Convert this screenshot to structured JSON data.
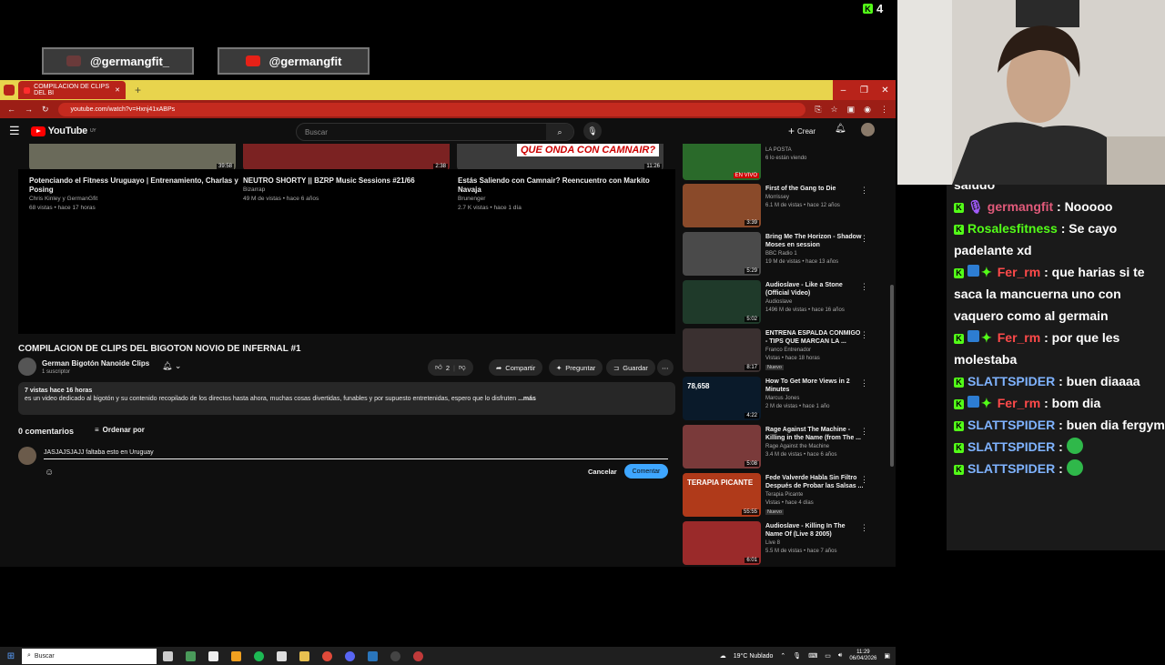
{
  "overlay": {
    "social_left": "@germangfit_",
    "social_right": "@germangfit",
    "kick_viewers": "4"
  },
  "browser": {
    "tab_title": "COMPILACION DE CLIPS DEL BI",
    "url": "youtube.com/watch?v=Hxnj41xABPs"
  },
  "youtube": {
    "logo": "YouTube",
    "logo_suffix": "UY",
    "search_placeholder": "Buscar",
    "create_label": "Crear",
    "related_top": [
      {
        "title": "Potenciando el Fitness Uruguayo | Entrenamiento, Charlas y Posing",
        "channel": "Chris Kinley y GermanGfit",
        "meta": "68 vistas • hace 17 horas",
        "duration": "39:58",
        "color": "#6a6a5a"
      },
      {
        "title": "NEUTRO SHORTY || BZRP Music Sessions #21/66",
        "channel": "Bizarrap",
        "meta": "49 M de vistas • hace 6 años",
        "duration": "2:38",
        "color": "#7b2222"
      },
      {
        "title": "Estás Saliendo con Camnair? Reencuentro con Markito Navaja",
        "channel": "Brunenger",
        "meta": "2.7 K vistas • hace 1 día",
        "duration": "11:26",
        "color": "#3b3b3b",
        "thumb_text": "QUE ONDA CON CAMNAIR?"
      }
    ],
    "video": {
      "title": "COMPILACION DE CLIPS DEL BIGOTON NOVIO DE INFERNAL #1",
      "channel": "German Bigotón Nanoide Clips",
      "subs": "1 suscriptor",
      "likes": "2",
      "share": "Compartir",
      "ask": "Preguntar",
      "save": "Guardar",
      "desc_stats": "7 vistas  hace 16 horas",
      "desc_text": "es un video dedicado al bigotón y su contenido recopilado de los directos hasta ahora, muchas cosas divertidas, funables y por supuesto entretenidas, espero que lo disfruten",
      "desc_more": "...más"
    },
    "comments": {
      "count": "0 comentarios",
      "sort": "Ordenar por",
      "draft": "JASJAJSJAJJ faltaba esto en Uruguay",
      "cancel": "Cancelar",
      "submit": "Comentar"
    },
    "sidebar": [
      {
        "title": "EN VIVO",
        "channel": "LA POSTA",
        "meta": "6 lo están viendo",
        "badge": "EN VIVO",
        "color": "#2a6a2a"
      },
      {
        "title": "First of the Gang to Die",
        "channel": "Morrissey",
        "meta": "6.1 M de vistas • hace 12 años",
        "duration": "3:39",
        "color": "#8a4a2a"
      },
      {
        "title": "Bring Me The Horizon - Shadow Moses en session",
        "channel": "BBC Radio 1",
        "meta": "19 M de vistas • hace 13 años",
        "duration": "5:29",
        "color": "#4a4a4a"
      },
      {
        "title": "Audioslave - Like a Stone (Official Video)",
        "channel": "Audioslave",
        "meta": "1496 M de vistas • hace 16 años",
        "duration": "5:02",
        "color": "#1f3a2a"
      },
      {
        "title": "ENTRENA ESPALDA CONMIGO - TIPS QUE MARCAN LA ...",
        "channel": "Franco Entrenador",
        "meta": "Vistas • hace 18 horas",
        "badge": "Nuevo",
        "duration": "8:17",
        "color": "#3a3030"
      },
      {
        "title": "How To Get More Views in 2 Minutes",
        "channel": "Marcus Jones",
        "meta": "2 M de vistas • hace 1 año",
        "duration": "4:22",
        "color": "#0a1a2a",
        "thumb_text": "78,658"
      },
      {
        "title": "Rage Against The Machine - Killing in the Name (from The ...",
        "channel": "Rage Against the Machine",
        "meta": "3.4 M de vistas • hace 6 años",
        "duration": "5:08",
        "color": "#7a3a3a"
      },
      {
        "title": "Fede Valverde Habla Sin Filtro Después de Probar las Salsas ...",
        "channel": "Terapia Picante",
        "meta": "Vistas • hace 4 días",
        "badge": "Nuevo",
        "duration": "55:55",
        "color": "#b03a1a",
        "thumb_text": "TERAPIA PICANTE"
      },
      {
        "title": "Audioslave - Killing In The Name Of (Live 8 2005)",
        "channel": "Live 8",
        "meta": "5.5 M de vistas • hace 7 años",
        "duration": "6:01",
        "color": "#9a2a2a"
      }
    ]
  },
  "taskbar": {
    "search": "Buscar",
    "weather": "19°C  Nublado",
    "time": "11:29",
    "date": "06/04/2026"
  },
  "chat": [
    {
      "user": "",
      "text": "saludo",
      "user_color": "#ffffff"
    },
    {
      "user": "germangfit",
      "text": ": Nooooo",
      "user_color": "#e05a7a",
      "badges": [
        "mic"
      ]
    },
    {
      "user": "Rosalesfitness",
      "text": ": Se cayo padelante xd",
      "user_color": "#53fc18"
    },
    {
      "user": "Fer_rm",
      "text": ": que harias si te saca la mancuerna uno con vaquero como al germain",
      "user_color": "#ff4a4a",
      "badges": [
        "sub",
        "gift"
      ]
    },
    {
      "user": "Fer_rm",
      "text": ": por que les molestaba",
      "user_color": "#ff4a4a",
      "badges": [
        "sub",
        "gift"
      ]
    },
    {
      "user": "SLATTSPIDER",
      "text": ": buen diaaaa",
      "user_color": "#7fb3ff"
    },
    {
      "user": "Fer_rm",
      "text": ": bom dia",
      "user_color": "#ff4a4a",
      "badges": [
        "sub",
        "gift"
      ]
    },
    {
      "user": "SLATTSPIDER",
      "text": ": buen dia fergym",
      "user_color": "#7fb3ff"
    },
    {
      "user": "SLATTSPIDER",
      "text": ":",
      "user_color": "#7fb3ff",
      "emote": true
    },
    {
      "user": "SLATTSPIDER",
      "text": ":",
      "user_color": "#7fb3ff",
      "emote": true
    }
  ]
}
